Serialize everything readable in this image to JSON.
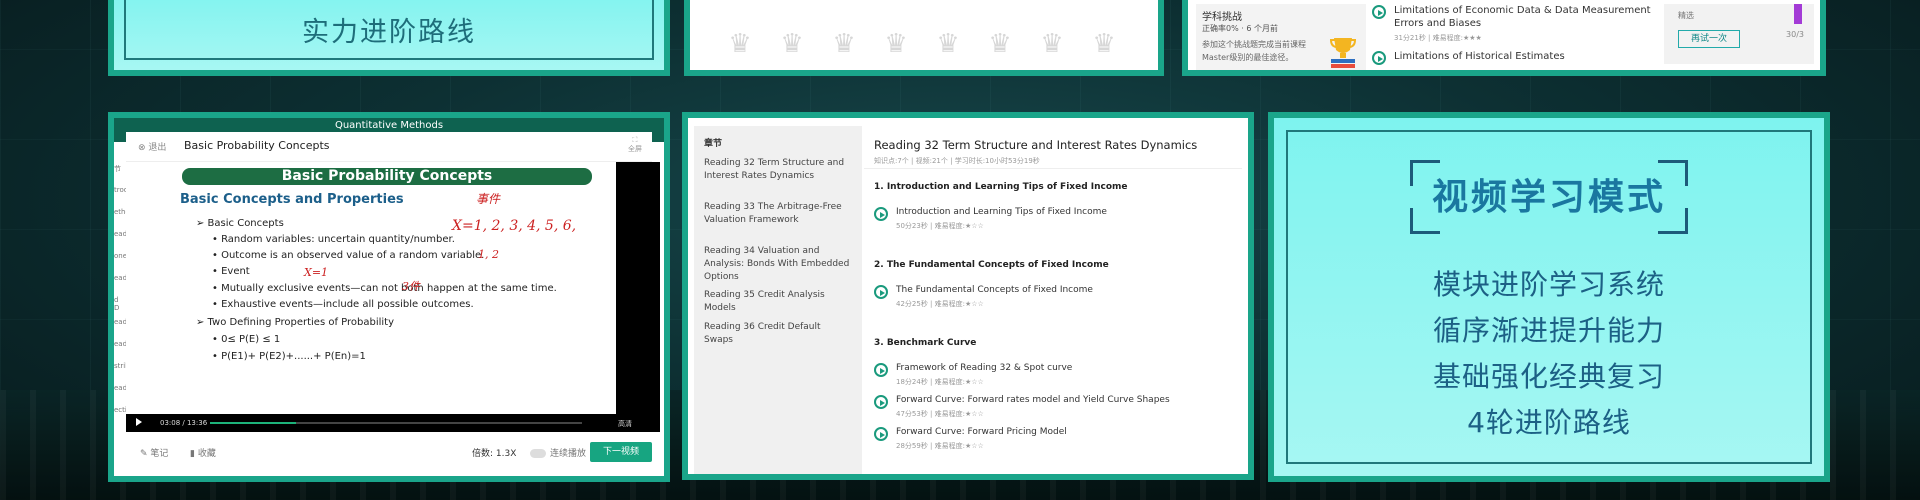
{
  "top_left": {
    "text": "实力进阶路线"
  },
  "top_middle": {
    "crown_count": 8
  },
  "top_right": {
    "challenge_title": "学科挑战",
    "challenge_rate": "正确率0% · 6 个月前",
    "challenge_desc": "参加这个挑战题完成当前课程Master级别的最佳途径。",
    "items": [
      {
        "title": "Limitations of Economic Data & Data Measurement Errors and Biases",
        "sub": "31分21秒 | 难易程度:★★★"
      },
      {
        "title": "Limitations of Historical Estimates",
        "sub": ""
      }
    ],
    "side_label": "精选",
    "retry_button": "再试一次",
    "side_count": "30/3"
  },
  "video": {
    "header": "Quantitative Methods",
    "exit": "退出",
    "title": "Basic Probability Concepts",
    "fullscreen": "全屏",
    "side_text": [
      "节",
      "trod",
      "etho",
      "eadi",
      "one",
      "eadi",
      "d D",
      "eadi",
      "eadi",
      "strib",
      "eadi",
      "ecti"
    ],
    "slide": {
      "title": "Basic Probability Concepts",
      "subtitle": "Basic Concepts and Properties",
      "lines": [
        "➢  Basic Concepts",
        "•     Random variables: uncertain quantity/number.",
        "•     Outcome is an observed value of a random variable.",
        "•     Event",
        "•     Mutually exclusive events—can not both happen at the same time.",
        "•     Exhaustive events—include all possible outcomes.",
        "➢  Two Defining Properties of Probability",
        "•     0≤ P(E) ≤ 1",
        "•     P(E1)+ P(E2)+......+ P(En)=1"
      ],
      "handwriting": [
        "X=1, 2, 3, 4, 5, 6,",
        "1, 2",
        "X=1",
        "3件",
        "事件"
      ]
    },
    "time": "03:08 / 13:36",
    "progress": 0.23,
    "ctrl_speed": "高清",
    "notes": "笔记",
    "favorite": "收藏",
    "speed_label": "倍数:",
    "speed_value": "1.3X",
    "autoplay": "连续播放",
    "next": "下一视频"
  },
  "course": {
    "side_header": "章节",
    "chapters": [
      "Reading 32 Term Structure and Interest Rates Dynamics",
      "Reading 33 The Arbitrage-Free Valuation Framework",
      "Reading 34 Valuation and Analysis: Bonds With Embedded Options",
      "Reading 35 Credit Analysis Models",
      "Reading 36 Credit Default Swaps"
    ],
    "title": "Reading 32 Term Structure and Interest Rates Dynamics",
    "meta": "知识点:7个 | 视频:21个 | 学习时长:10小时53分19秒",
    "sections": [
      {
        "name": "1. Introduction and Learning Tips of Fixed Income",
        "lessons": [
          {
            "title": "Introduction and Learning Tips of Fixed Income",
            "sub": "50分23秒 | 难易程度:★☆☆"
          }
        ]
      },
      {
        "name": "2. The Fundamental Concepts of Fixed Income",
        "lessons": [
          {
            "title": "The Fundamental Concepts of Fixed Income",
            "sub": "42分25秒 | 难易程度:★☆☆"
          }
        ]
      },
      {
        "name": "3. Benchmark Curve",
        "lessons": [
          {
            "title": "Framework of Reading 32 & Spot curve",
            "sub": "18分24秒 | 难易程度:★☆☆"
          },
          {
            "title": "Forward Curve: Forward rates model and Yield Curve Shapes",
            "sub": "47分53秒 | 难易程度:★☆☆"
          },
          {
            "title": "Forward Curve: Forward Pricing Model",
            "sub": "28分59秒 | 难易程度:★☆☆"
          }
        ]
      }
    ]
  },
  "right_panel": {
    "title": "视频学习模式",
    "lines": [
      "模块进阶学习系统",
      "循序渐进提升能力",
      "基础强化经典复习",
      "4轮进阶路线"
    ]
  },
  "colors": {
    "accent": "#1aa58a",
    "teal_bg": "#8ef5f1",
    "title_blue": "#1a77a0"
  }
}
